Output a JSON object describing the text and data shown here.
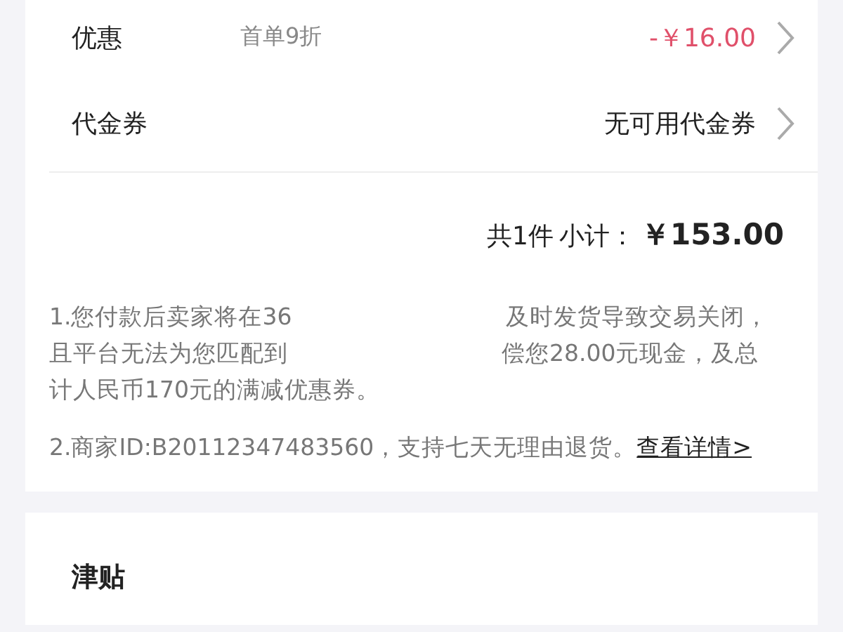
{
  "rows": [
    {
      "label": "优惠",
      "note": "首单9折",
      "value": "-￥16.00",
      "kind": "discount"
    },
    {
      "label": "代金券",
      "value": "无可用代金券",
      "kind": "plain"
    }
  ],
  "subtotal": {
    "count": "共1件",
    "label": "小计：",
    "amount": "￥153.00"
  },
  "notice": {
    "lines": [
      [
        "1.您付款后卖家将在36",
        "及时发货导致交易关闭，"
      ],
      [
        "且平台无法为您匹配到",
        "偿您28.00元现金，及总"
      ],
      [
        "计人民币170元的满减优惠券。"
      ]
    ],
    "merchant": "2.商家ID:B20112347483560，支持七天无理由退货。",
    "link": "查看详情>"
  },
  "section2": {
    "title": "津贴"
  }
}
